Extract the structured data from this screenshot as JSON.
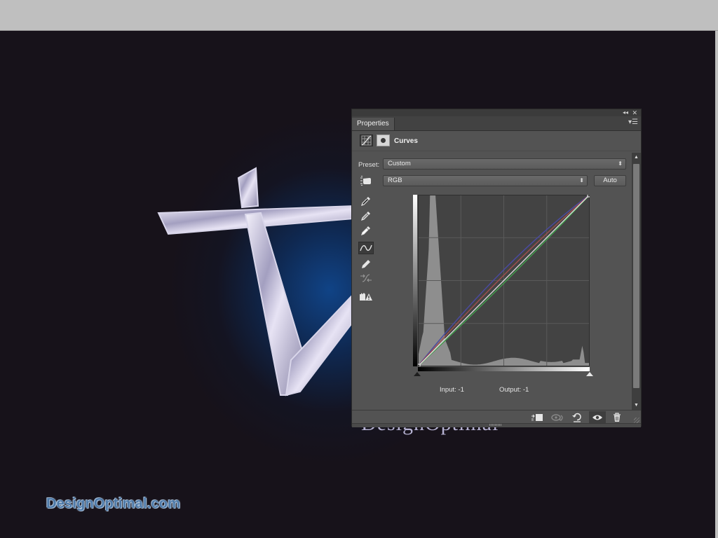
{
  "app": {
    "background_color": "#bfbfbf",
    "canvas_color": "#17121a"
  },
  "artwork": {
    "serif_text": "DesignOptimal",
    "watermark": "DesignOptimal.com"
  },
  "panel": {
    "tab_label": "Properties",
    "collapse_icon": "double-chevron-left-icon",
    "close_icon": "close-icon",
    "menu_icon": "panel-menu-icon",
    "adjustment_title": "Curves",
    "preset_label": "Preset:",
    "preset_value": "Custom",
    "channel_value": "RGB",
    "auto_label": "Auto",
    "tools": [
      {
        "name": "sample-black-point-eyedropper",
        "icon": "eyedropper-icon"
      },
      {
        "name": "sample-gray-point-eyedropper",
        "icon": "eyedropper-icon"
      },
      {
        "name": "sample-white-point-eyedropper",
        "icon": "eyedropper-icon"
      },
      {
        "name": "edit-points-curve-tool",
        "icon": "curve-icon",
        "active": true
      },
      {
        "name": "draw-curve-pencil-tool",
        "icon": "pencil-icon"
      },
      {
        "name": "smooth-curve-tool",
        "icon": "smooth-icon"
      },
      {
        "name": "clipping-warning-tool",
        "icon": "clipping-warning-icon"
      }
    ],
    "input_label": "Input:",
    "input_value": "-1",
    "output_label": "Output:",
    "output_value": "-1",
    "bottom_buttons": [
      {
        "name": "clip-to-layer-button",
        "icon": "clip-to-layer-icon"
      },
      {
        "name": "view-previous-state-button",
        "icon": "view-previous-icon"
      },
      {
        "name": "reset-button",
        "icon": "reset-icon"
      },
      {
        "name": "toggle-visibility-button",
        "icon": "eye-icon",
        "active": true
      },
      {
        "name": "delete-button",
        "icon": "trash-icon"
      }
    ]
  },
  "curves": {
    "input_range": [
      0,
      255
    ],
    "output_range": [
      0,
      255
    ],
    "colors": {
      "rgb": "#e6e6e6",
      "red": "#9b4f4f",
      "green": "#3f9a4a",
      "blue": "#4a4aa0"
    },
    "rgb_points": [
      [
        0,
        0
      ],
      [
        255,
        255
      ]
    ],
    "red_points": [
      [
        0,
        0
      ],
      [
        128,
        136
      ],
      [
        255,
        255
      ]
    ],
    "green_points": [
      [
        0,
        0
      ],
      [
        128,
        124
      ],
      [
        255,
        255
      ]
    ],
    "blue_points": [
      [
        0,
        0
      ],
      [
        128,
        144
      ],
      [
        255,
        255
      ]
    ],
    "histogram_description": "tall peak near input ~20-30 (shadows), long low tail across midtones, small peak near input ~245"
  }
}
